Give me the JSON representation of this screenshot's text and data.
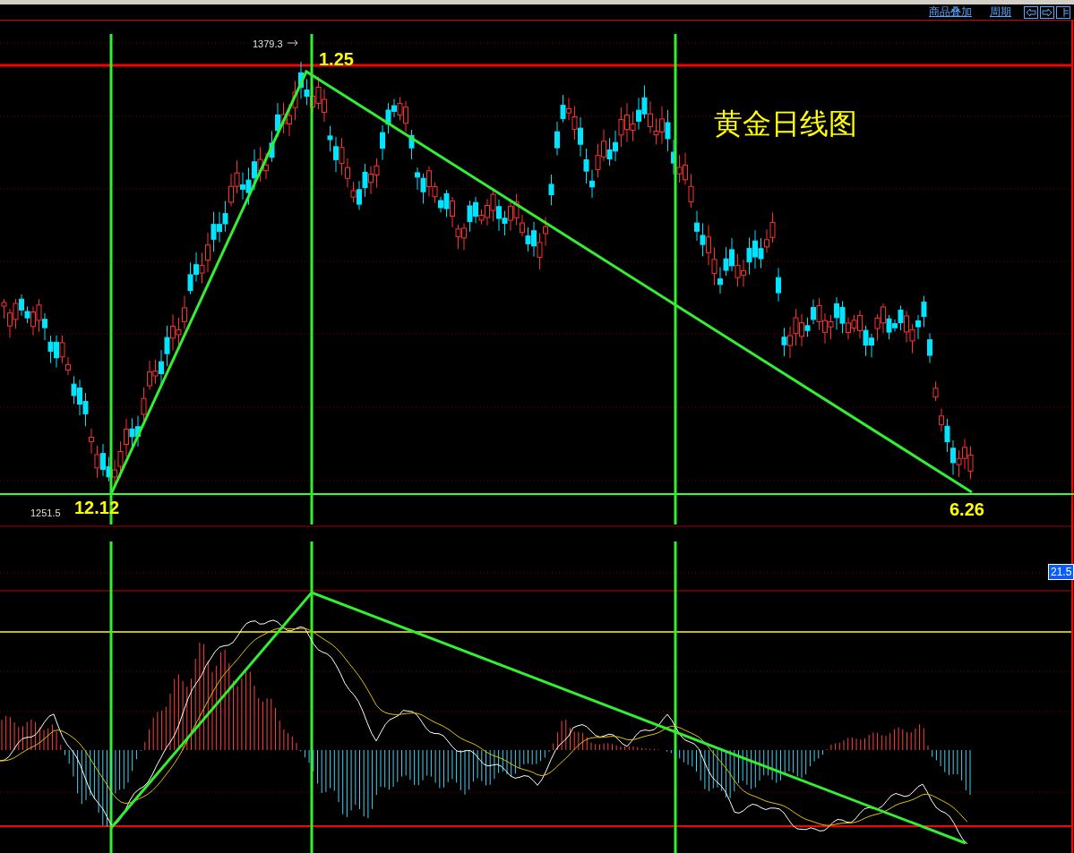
{
  "toolbar": {
    "links": [
      "商品叠加",
      "周期"
    ]
  },
  "chart_title": "黄金日线图",
  "price_panel": {
    "high_marker": "1379.3",
    "low_marker": "1251.5",
    "date_labels": [
      "12.12",
      "1.25",
      "6.26"
    ]
  },
  "indicator_panel": {
    "value_badge": "21.5"
  }
}
